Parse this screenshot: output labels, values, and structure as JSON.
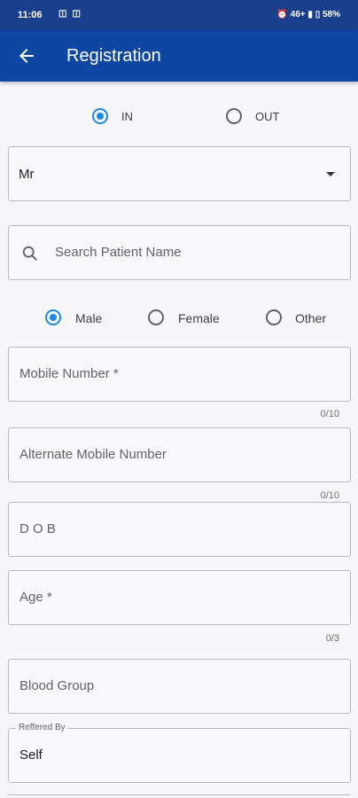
{
  "status": {
    "time": "11:06",
    "battery": "58%",
    "network": "46+"
  },
  "appbar": {
    "title": "Registration"
  },
  "visit_type": {
    "in_label": "IN",
    "out_label": "OUT"
  },
  "salutation": {
    "value": "Mr"
  },
  "search": {
    "placeholder": "Search Patient Name"
  },
  "gender": {
    "male": "Male",
    "female": "Female",
    "other": "Other"
  },
  "fields": {
    "mobile": {
      "placeholder": "Mobile Number *",
      "counter": "0/10"
    },
    "alt_mobile": {
      "placeholder": "Alternate Mobile Number",
      "counter": "0/10"
    },
    "dob": {
      "placeholder": "D O B"
    },
    "age": {
      "placeholder": "Age *",
      "counter": "0/3"
    },
    "blood_group": {
      "placeholder": "Blood Group"
    },
    "referred_by": {
      "label": "Reffered By",
      "value": "Self"
    }
  }
}
